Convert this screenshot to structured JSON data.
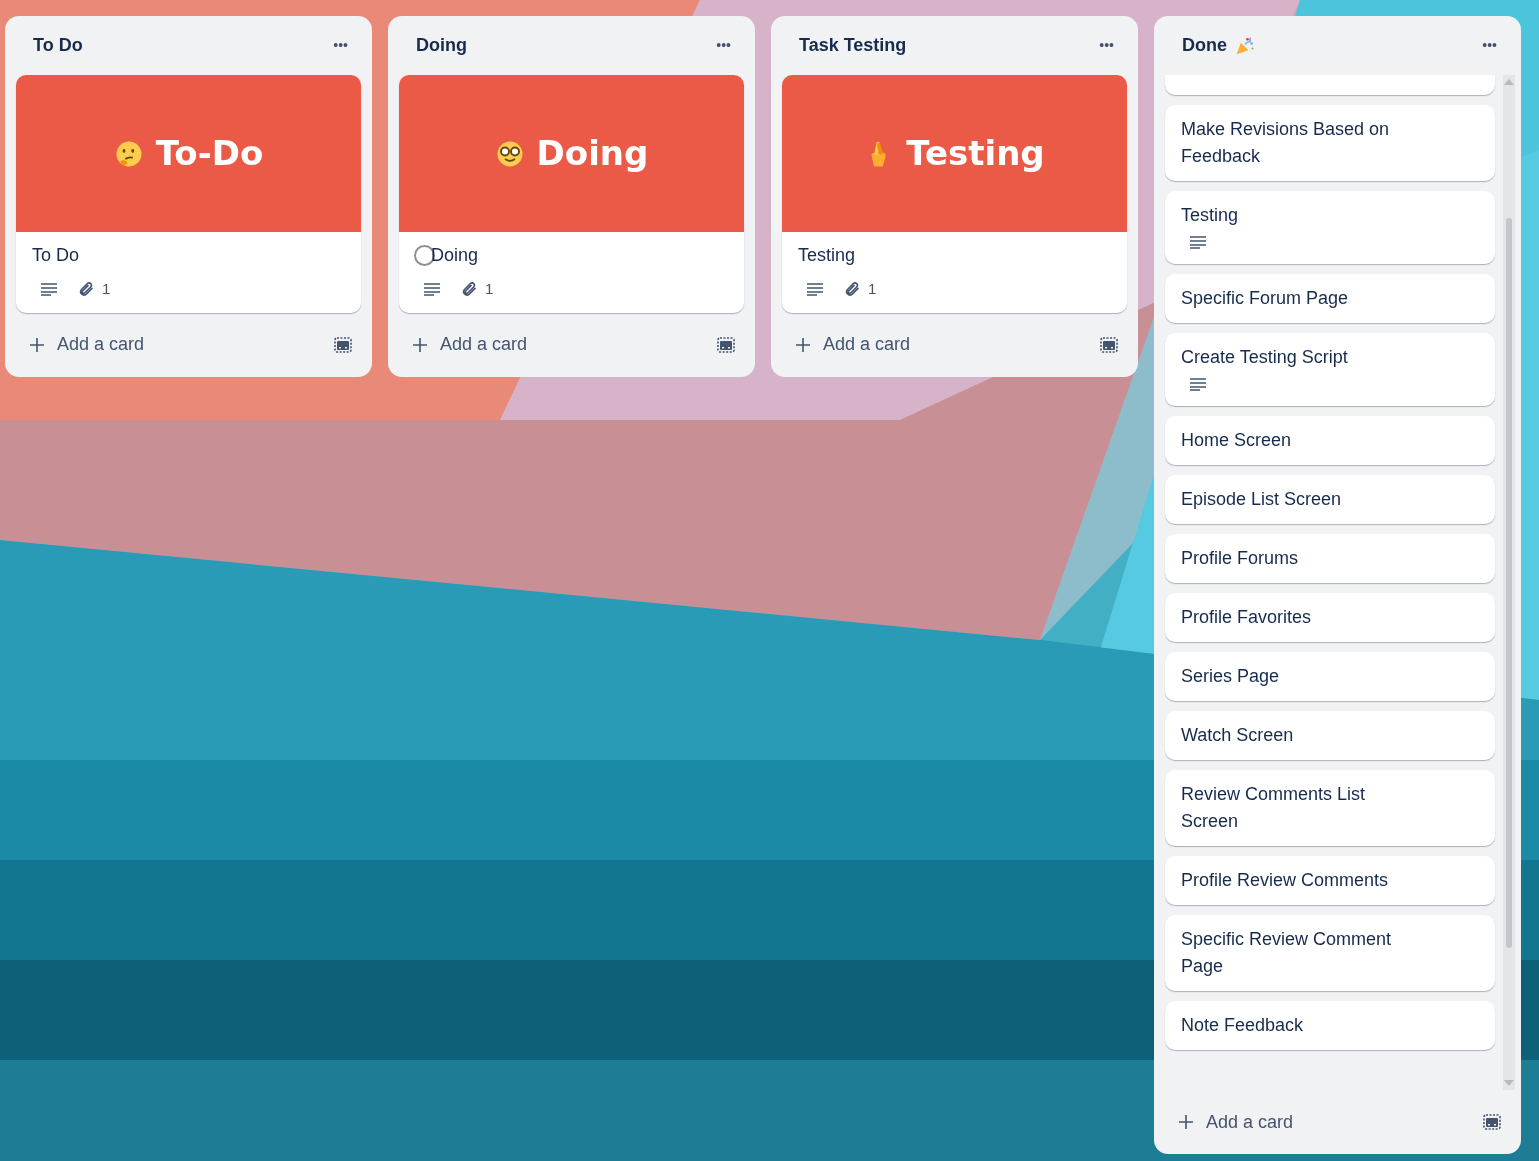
{
  "lists": [
    {
      "title": "To Do",
      "menu": "•••",
      "cards": [
        {
          "kind": "cover",
          "cover_emoji": {
            "kind": "thinking"
          },
          "cover_title": "To-Do",
          "title": "To Do",
          "description": true,
          "attachments": "1"
        }
      ],
      "add_card": "Add a card"
    },
    {
      "title": "Doing",
      "menu": "•••",
      "cards": [
        {
          "kind": "cover",
          "cover_emoji": {
            "kind": "nerd"
          },
          "cover_title": "Doing",
          "title": "Doing",
          "completed": false,
          "description": true,
          "attachments": "1"
        }
      ],
      "add_card": "Add a card"
    },
    {
      "title": "Task Testing",
      "menu": "•••",
      "cards": [
        {
          "kind": "cover",
          "cover_emoji": {
            "kind": "fingers"
          },
          "cover_title": "Testing",
          "title": "Testing",
          "description": true,
          "attachments": "1"
        }
      ],
      "add_card": "Add a card"
    },
    {
      "title": "Done",
      "header_emoji": {
        "kind": "party"
      },
      "menu": "•••",
      "scrollable": true,
      "cards": [
        {
          "kind": "clipped"
        },
        {
          "kind": "plain",
          "title": "Make Revisions Based on Feedback",
          "description": false
        },
        {
          "kind": "plain",
          "title": "Testing",
          "description": true
        },
        {
          "kind": "plain",
          "title": "Specific Forum Page",
          "description": false
        },
        {
          "kind": "plain",
          "title": "Create Testing Script",
          "description": true
        },
        {
          "kind": "plain",
          "title": "Home Screen",
          "description": false
        },
        {
          "kind": "plain",
          "title": "Episode List Screen",
          "description": false
        },
        {
          "kind": "plain",
          "title": "Profile Forums",
          "description": false
        },
        {
          "kind": "plain",
          "title": "Profile Favorites",
          "description": false
        },
        {
          "kind": "plain",
          "title": "Series Page",
          "description": false
        },
        {
          "kind": "plain",
          "title": "Watch Screen",
          "description": false
        },
        {
          "kind": "plain",
          "title": "Review Comments List Screen",
          "description": false
        },
        {
          "kind": "plain",
          "title": "Profile Review Comments",
          "description": false
        },
        {
          "kind": "plain",
          "title": "Specific Review Comment Page",
          "description": false
        },
        {
          "kind": "plain",
          "title": "Note Feedback",
          "description": false
        }
      ],
      "add_card": "Add a card"
    }
  ]
}
